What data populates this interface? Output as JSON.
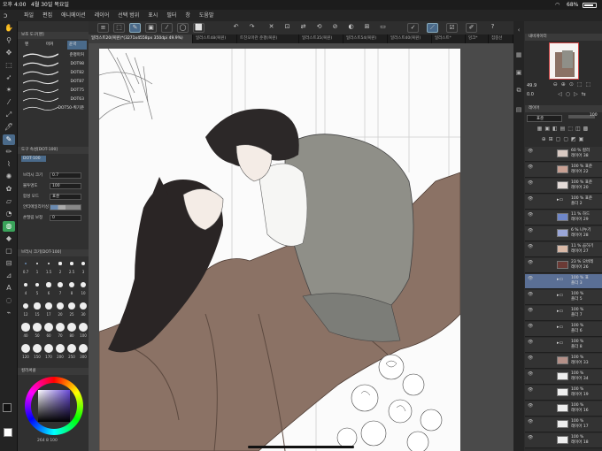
{
  "status": {
    "time": "오후 4:00",
    "date": "4월 30일 목요일",
    "battery": "68%"
  },
  "menu": [
    "파일",
    "편집",
    "애니메이션",
    "레이어",
    "선택 범위",
    "표시",
    "필터",
    "창",
    "도움말"
  ],
  "tabs": [
    {
      "label": "일러스트20(복원)*(3271x4558px 350dpi 49.9%)"
    },
    {
      "label": "일러스트48(복원)"
    },
    {
      "label": "트친오마관 준평(복원)"
    },
    {
      "label": "일러스트35(복원)"
    },
    {
      "label": "일러스트54(복원)"
    },
    {
      "label": "일러스트40(복원)"
    },
    {
      "label": "일러스트*"
    },
    {
      "label": "잉크*"
    },
    {
      "label": "집중선"
    }
  ],
  "left_panel": {
    "subtool_header": "보조 도구[펜]",
    "subtool_tabs": [
      "펜",
      "마커",
      "윤곽"
    ],
    "brushes": [
      "준평마커",
      "DOT98",
      "DOT82",
      "DOT87",
      "DOT75",
      "DOT63",
      "DOT50-획기준"
    ],
    "tool_prop_header": "도구 속성[DOT-100]",
    "brush_name": "DOT-100",
    "props": [
      {
        "label": "브러시 크기",
        "value": "0.7"
      },
      {
        "label": "불투명도",
        "value": "100"
      },
      {
        "label": "합성 모드",
        "value": "표준"
      },
      {
        "label": "안티에일리어싱",
        "value": ""
      },
      {
        "label": "손떨림 보정",
        "value": "0"
      }
    ],
    "brush_size_header": "브러시 크기[DOT-100]",
    "brush_sizes": [
      "0.7",
      "1",
      "1.5",
      "2",
      "2.5",
      "3",
      "4",
      "5",
      "6",
      "7",
      "8",
      "10",
      "12",
      "15",
      "17",
      "20",
      "25",
      "30",
      "40",
      "50",
      "60",
      "70",
      "80",
      "100",
      "120",
      "150",
      "170",
      "200",
      "250",
      "300"
    ],
    "color_header": "컬러써클",
    "color_readout": "264 8 100"
  },
  "right_panel": {
    "navigator_header": "내비게이터",
    "zoom": "49.9",
    "rotation": "0.0",
    "layer_header": "레이어",
    "blend": "표준",
    "opacity": "100"
  },
  "layers": [
    {
      "pct": "60 %",
      "mode": "컬러",
      "name": "레이어 38",
      "thumb": "#d8c9c2",
      "group": false,
      "sel": false
    },
    {
      "pct": "100 %",
      "mode": "표준",
      "name": "레이어 22",
      "thumb": "#c8a093",
      "group": false,
      "sel": false
    },
    {
      "pct": "100 %",
      "mode": "표준",
      "name": "레이어 20",
      "thumb": "#e4dbd8",
      "group": false,
      "sel": false
    },
    {
      "pct": "100 %",
      "mode": "표준",
      "name": "폴더 2",
      "thumb": "",
      "group": true,
      "sel": false
    },
    {
      "pct": "11 %",
      "mode": "하드",
      "name": "레이어 29",
      "thumb": "#6e86c8",
      "group": false,
      "sel": false
    },
    {
      "pct": "6 %",
      "mode": "나누기",
      "name": "레이어 28",
      "thumb": "#9aa6d8",
      "group": false,
      "sel": false
    },
    {
      "pct": "11 %",
      "mode": "곱하기",
      "name": "레이어 27",
      "thumb": "#d9b9a7",
      "group": false,
      "sel": false
    },
    {
      "pct": "23 %",
      "mode": "오버레",
      "name": "레이어 26",
      "thumb": "#6b3a35",
      "group": false,
      "sel": false
    },
    {
      "pct": "100 %",
      "mode": "표",
      "name": "폴더 3",
      "thumb": "",
      "group": true,
      "sel": true
    },
    {
      "pct": "100 %",
      "mode": "",
      "name": "폴더 5",
      "thumb": "",
      "group": true,
      "sel": false
    },
    {
      "pct": "100 %",
      "mode": "",
      "name": "폴더 7",
      "thumb": "",
      "group": true,
      "sel": false
    },
    {
      "pct": "100 %",
      "mode": "",
      "name": "폴더 6",
      "thumb": "",
      "group": true,
      "sel": false
    },
    {
      "pct": "100 %",
      "mode": "",
      "name": "폴더 8",
      "thumb": "",
      "group": true,
      "sel": false
    },
    {
      "pct": "100 %",
      "mode": "",
      "name": "레이어 33",
      "thumb": "#b49088",
      "group": false,
      "sel": false
    },
    {
      "pct": "100 %",
      "mode": "",
      "name": "레이어 34",
      "thumb": "#eeeeee",
      "group": false,
      "sel": false
    },
    {
      "pct": "100 %",
      "mode": "",
      "name": "레이어 19",
      "thumb": "#eeeeee",
      "group": false,
      "sel": false
    },
    {
      "pct": "100 %",
      "mode": "",
      "name": "레이어 16",
      "thumb": "#eeeeee",
      "group": false,
      "sel": false
    },
    {
      "pct": "100 %",
      "mode": "",
      "name": "레이어 17",
      "thumb": "#eeeeee",
      "group": false,
      "sel": false
    },
    {
      "pct": "100 %",
      "mode": "",
      "name": "레이어 18",
      "thumb": "#eeeeee",
      "group": false,
      "sel": false
    }
  ],
  "colors": {
    "accent": "#4a6a8a",
    "selected_layer": "#5a6f95",
    "brown": "#8b7265",
    "gray_vest": "#8f8f88"
  }
}
